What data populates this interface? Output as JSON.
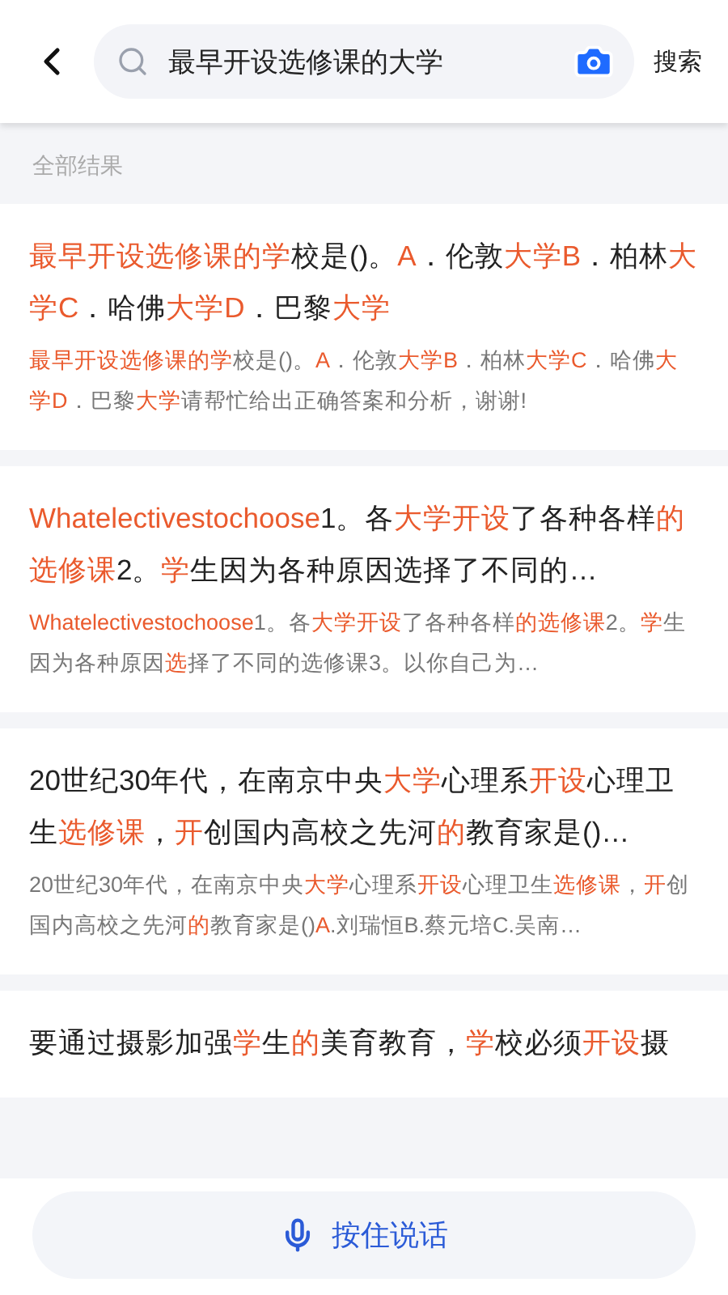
{
  "search": {
    "value": "最早开设选修课的大学",
    "action": "搜索"
  },
  "section_label": "全部结果",
  "results": [
    {
      "title": [
        {
          "text": "最早开设选修课的学",
          "highlight": true
        },
        {
          "text": "校是()。",
          "highlight": false
        },
        {
          "text": "A",
          "highlight": true
        },
        {
          "text": "．伦敦",
          "highlight": false
        },
        {
          "text": "大学B",
          "highlight": true
        },
        {
          "text": "．柏林",
          "highlight": false
        },
        {
          "text": "大学C",
          "highlight": true
        },
        {
          "text": "．哈佛",
          "highlight": false
        },
        {
          "text": "大学D",
          "highlight": true
        },
        {
          "text": "．巴黎",
          "highlight": false
        },
        {
          "text": "大学",
          "highlight": true
        }
      ],
      "snippet": [
        {
          "text": "最早开设选修课的学",
          "highlight": true
        },
        {
          "text": "校是()。",
          "highlight": false
        },
        {
          "text": "A",
          "highlight": true
        },
        {
          "text": "．伦敦",
          "highlight": false
        },
        {
          "text": "大学B",
          "highlight": true
        },
        {
          "text": "．柏林",
          "highlight": false
        },
        {
          "text": "大学C",
          "highlight": true
        },
        {
          "text": "．哈佛",
          "highlight": false
        },
        {
          "text": "大学D",
          "highlight": true
        },
        {
          "text": "．巴黎",
          "highlight": false
        },
        {
          "text": "大学",
          "highlight": true
        },
        {
          "text": "请帮忙给出正确答案和分析，谢谢!",
          "highlight": false
        }
      ]
    },
    {
      "title": [
        {
          "text": "Whatelectivestochoose",
          "highlight": true
        },
        {
          "text": "1。各",
          "highlight": false
        },
        {
          "text": "大学开设",
          "highlight": true
        },
        {
          "text": "了各种各样",
          "highlight": false
        },
        {
          "text": "的选修课",
          "highlight": true
        },
        {
          "text": "2。",
          "highlight": false
        },
        {
          "text": "学",
          "highlight": true
        },
        {
          "text": "生因为各种原因选择了不同的…",
          "highlight": false
        }
      ],
      "snippet": [
        {
          "text": "Whatelectivestochoose",
          "highlight": true
        },
        {
          "text": "1。各",
          "highlight": false
        },
        {
          "text": "大学开设",
          "highlight": true
        },
        {
          "text": "了各种各样",
          "highlight": false
        },
        {
          "text": "的选修课",
          "highlight": true
        },
        {
          "text": "2。",
          "highlight": false
        },
        {
          "text": "学",
          "highlight": true
        },
        {
          "text": "生因为各种原因",
          "highlight": false
        },
        {
          "text": "选",
          "highlight": true
        },
        {
          "text": "择了不同的选修课3。以你自己为…",
          "highlight": false
        }
      ]
    },
    {
      "title": [
        {
          "text": "20世纪30年代，在南京中央",
          "highlight": false
        },
        {
          "text": "大学",
          "highlight": true
        },
        {
          "text": "心理系",
          "highlight": false
        },
        {
          "text": "开设",
          "highlight": true
        },
        {
          "text": "心理卫生",
          "highlight": false
        },
        {
          "text": "选修课",
          "highlight": true
        },
        {
          "text": "，",
          "highlight": false
        },
        {
          "text": "开",
          "highlight": true
        },
        {
          "text": "创国内高校之先河",
          "highlight": false
        },
        {
          "text": "的",
          "highlight": true
        },
        {
          "text": "教育家是()…",
          "highlight": false
        }
      ],
      "snippet": [
        {
          "text": "20世纪30年代，在南京中央",
          "highlight": false
        },
        {
          "text": "大学",
          "highlight": true
        },
        {
          "text": "心理系",
          "highlight": false
        },
        {
          "text": "开设",
          "highlight": true
        },
        {
          "text": "心理卫生",
          "highlight": false
        },
        {
          "text": "选修课",
          "highlight": true
        },
        {
          "text": "，",
          "highlight": false
        },
        {
          "text": "开",
          "highlight": true
        },
        {
          "text": "创国内高校之先河",
          "highlight": false
        },
        {
          "text": "的",
          "highlight": true
        },
        {
          "text": "教育家是()",
          "highlight": false
        },
        {
          "text": "A",
          "highlight": true
        },
        {
          "text": ".刘瑞恒B.蔡元培C.吴南…",
          "highlight": false
        }
      ]
    },
    {
      "title": [
        {
          "text": "要通过摄影加强",
          "highlight": false
        },
        {
          "text": "学",
          "highlight": true
        },
        {
          "text": "生",
          "highlight": false
        },
        {
          "text": "的",
          "highlight": true
        },
        {
          "text": "美育教育，",
          "highlight": false
        },
        {
          "text": "学",
          "highlight": true
        },
        {
          "text": "校必须",
          "highlight": false
        },
        {
          "text": "开设",
          "highlight": true
        },
        {
          "text": "摄",
          "highlight": false
        }
      ]
    }
  ],
  "voice_button": "按住说话"
}
